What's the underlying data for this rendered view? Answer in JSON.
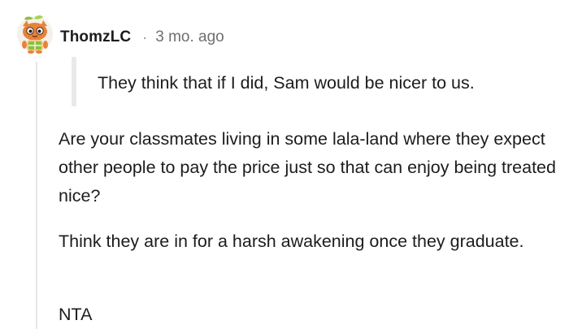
{
  "comment": {
    "author": "ThomzLC",
    "separator": "·",
    "timestamp": "3 mo. ago",
    "quote": "They think that if I did, Sam would be nicer to us.",
    "paragraphs": [
      "Are your classmates living in some lala-land where they expect other people to pay the price just so that can enjoy being treated nice?",
      "Think they are in for a harsh awakening once they graduate.",
      "NTA"
    ]
  },
  "colors": {
    "text": "#1c1c1c",
    "meta": "#6f6f6f",
    "thread_line": "#e6e6e6",
    "quote_bar": "#e9e9e9",
    "avatar_orange": "#e8823a",
    "avatar_green": "#8dbf3d"
  },
  "icons": {
    "avatar": "snoo-avatar-icon"
  }
}
